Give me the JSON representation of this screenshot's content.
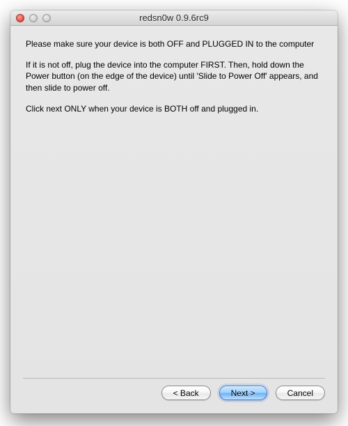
{
  "window": {
    "title": "redsn0w 0.9.6rc9"
  },
  "body": {
    "p1": "Please make sure your device is both OFF and PLUGGED IN to the computer",
    "p2": "If it is not off, plug the device into the computer FIRST. Then, hold down the Power button (on the edge of the device) until 'Slide to Power Off' appears, and then slide to power off.",
    "p3": "Click next ONLY when your device is BOTH off and plugged in."
  },
  "buttons": {
    "back": "< Back",
    "next": "Next >",
    "cancel": "Cancel"
  }
}
